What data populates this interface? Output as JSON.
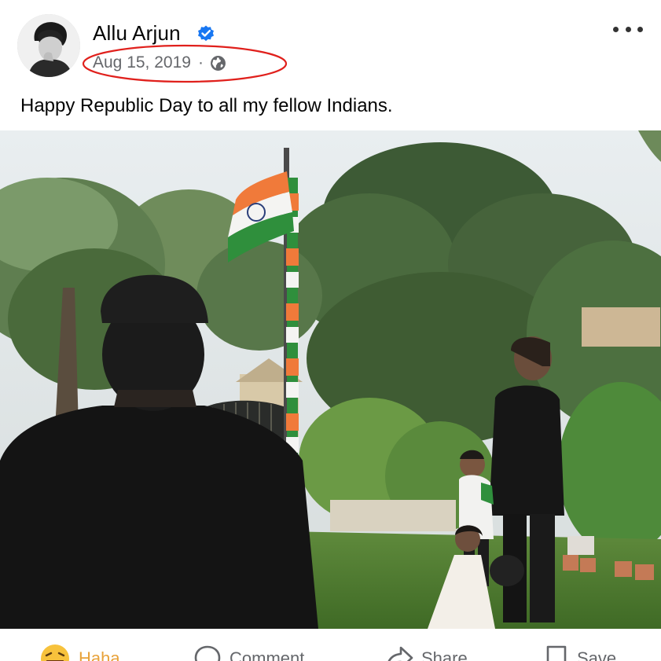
{
  "post": {
    "author_name": "Allu Arjun",
    "verified_icon": "verified-badge-icon",
    "date": "Aug 15, 2019",
    "separator": "·",
    "audience_icon": "globe-icon",
    "more_icon": "more-options-icon",
    "caption": "Happy Republic Day to all my fellow Indians.",
    "annotation_color": "#e0201c"
  },
  "photo": {
    "flag_colors": {
      "saffron": "#f07a3a",
      "white": "#f4f4f2",
      "green": "#2f8f3c",
      "chakra": "#2b3f7a"
    }
  },
  "actions": [
    {
      "label": "Haha",
      "icon": "haha-reaction-icon",
      "active": true
    },
    {
      "label": "Comment",
      "icon": "comment-icon",
      "active": false
    },
    {
      "label": "Share",
      "icon": "share-icon",
      "active": false
    },
    {
      "label": "Save",
      "icon": "save-icon",
      "active": false
    }
  ],
  "colors": {
    "accent_blue": "#1877f2",
    "meta_gray": "#65676b",
    "haha_orange": "#e8a23a"
  }
}
